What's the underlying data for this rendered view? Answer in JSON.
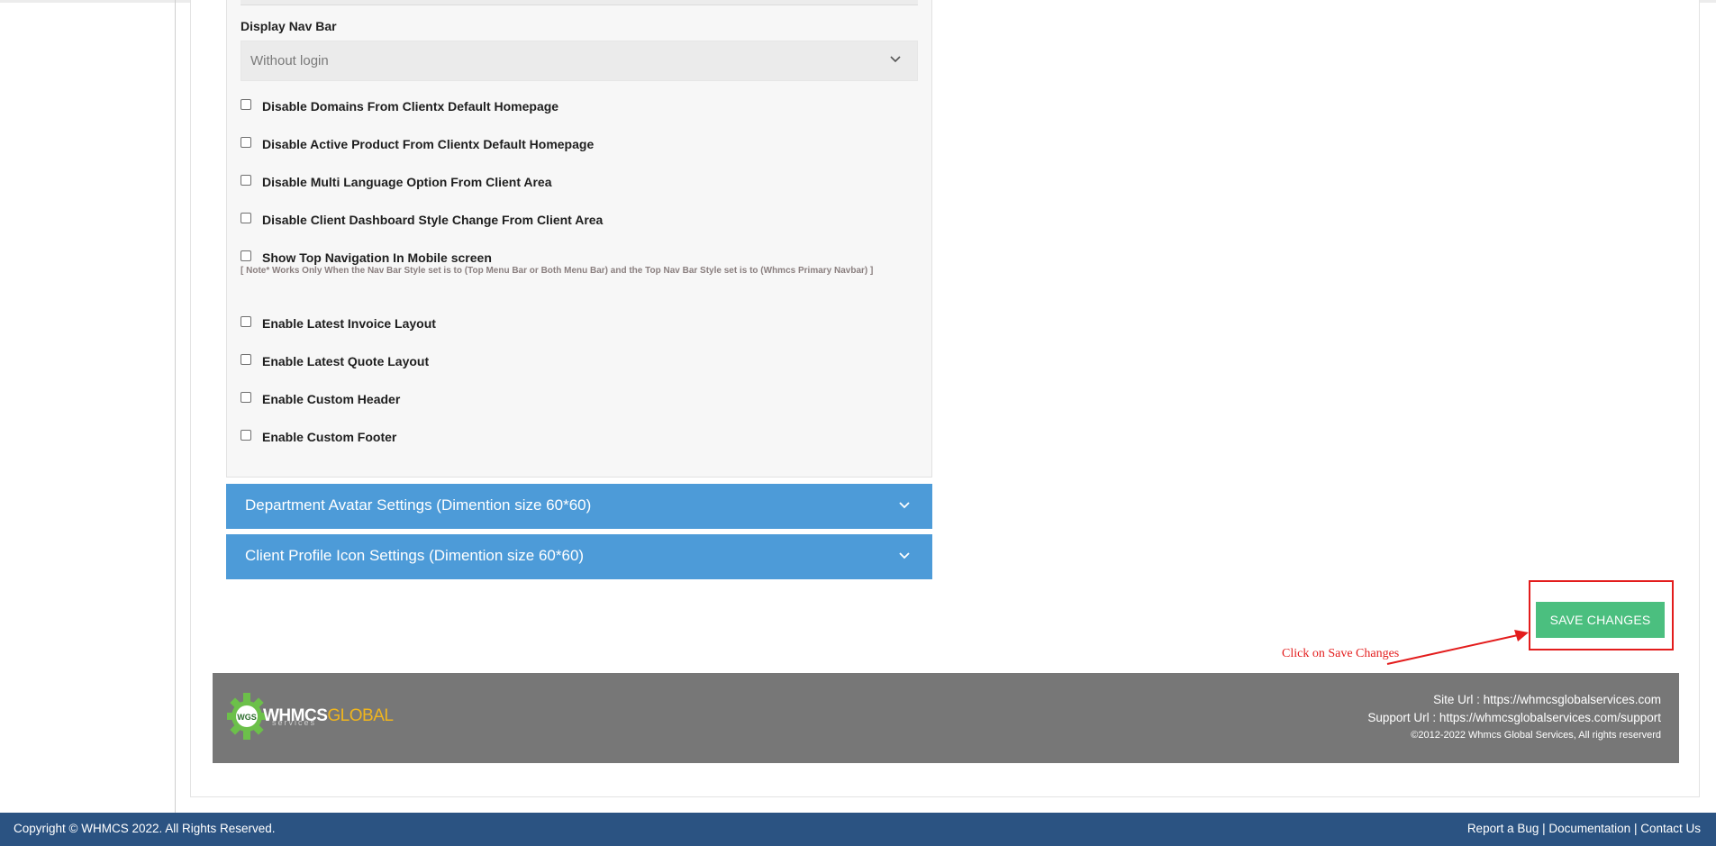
{
  "settings": {
    "display_nav_bar_label": "Display Nav Bar",
    "display_nav_bar_value": "Without login",
    "checkboxes": [
      {
        "label": "Disable Domains From Clientx Default Homepage",
        "checked": false
      },
      {
        "label": "Disable Active Product From Clientx Default Homepage",
        "checked": false
      },
      {
        "label": "Disable Multi Language Option From Client Area",
        "checked": false
      },
      {
        "label": "Disable Client Dashboard Style Change From Client Area",
        "checked": false
      },
      {
        "label": "Show Top Navigation In Mobile screen",
        "checked": false
      },
      {
        "label": "Enable Latest Invoice Layout",
        "checked": false
      },
      {
        "label": "Enable Latest Quote Layout",
        "checked": false
      },
      {
        "label": "Enable Custom Header",
        "checked": false
      },
      {
        "label": "Enable Custom Footer",
        "checked": false
      }
    ],
    "mobile_nav_note": "[ Note* Works Only When the Nav Bar Style set is to (Top Menu Bar or Both Menu Bar) and the Top Nav Bar Style set is to (Whmcs Primary Navbar) ]"
  },
  "accordions": [
    {
      "title": "Department Avatar Settings (Dimention size 60*60)"
    },
    {
      "title": "Client Profile Icon Settings (Dimention size 60*60)"
    }
  ],
  "actions": {
    "save_label": "SAVE CHANGES"
  },
  "annotation": {
    "text": "Click on Save Changes",
    "color": "#e31c1c"
  },
  "brand_footer": {
    "logo_badge": "WGS",
    "logo_main": "WHMCS",
    "logo_accent": "GLOBAL",
    "logo_sub": "services",
    "site_url": "Site Url : https://whmcsglobalservices.com",
    "support_url": "Support Url : https://whmcsglobalservices.com/support",
    "copyright": "©2012-2022 Whmcs Global Services, All rights reserverd"
  },
  "bottom_bar": {
    "copyright": "Copyright © WHMCS 2022. All Rights Reserved.",
    "links": [
      "Report a Bug",
      "Documentation",
      "Contact Us"
    ],
    "separator": " | "
  },
  "colors": {
    "accordion": "#4d9bd8",
    "save_button": "#4bbf7f",
    "brand_footer_bg": "#777777",
    "bottom_bar_bg": "#2b5382",
    "logo_accent": "#f0b51d"
  }
}
